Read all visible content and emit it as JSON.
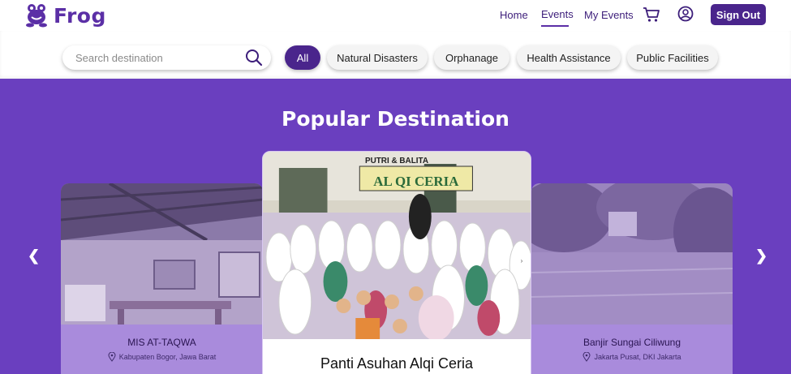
{
  "brand": {
    "name": "Frog"
  },
  "nav": {
    "home": "Home",
    "events": "Events",
    "my_events": "My Events",
    "sign_out": "Sign Out"
  },
  "search": {
    "placeholder": "Search destination"
  },
  "filters": [
    "All",
    "Natural Disasters",
    "Orphanage",
    "Health Assistance",
    "Public Facilities"
  ],
  "active_filter": "All",
  "section": {
    "title": "Popular Destination"
  },
  "cards": [
    {
      "name": "MIS AT-TAQWA",
      "location": "Kabupaten Bogor, Jawa Barat",
      "sign_text": ""
    },
    {
      "name": "Panti Asuhan Alqi Ceria",
      "location": "",
      "sign_text_top": "PUTRI & BALITA",
      "sign_text": "AL QI CERIA"
    },
    {
      "name": "Banjir Sungai Ciliwung",
      "location": "Jakarta Pusat, DKI Jakarta"
    }
  ],
  "carousel": {
    "prev": "❮",
    "next": "❯"
  },
  "colors": {
    "brand": "#4a258c",
    "hero": "#6a3fbf",
    "card_side": "#a98bdc"
  },
  "icons": [
    "frog-logo-icon",
    "cart-icon",
    "user-icon",
    "search-icon",
    "location-pin-icon"
  ]
}
